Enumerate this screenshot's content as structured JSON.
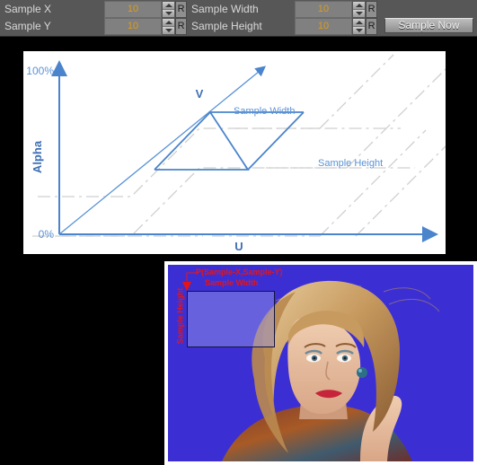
{
  "toolbar": {
    "fields": [
      {
        "label": "Sample X",
        "value": "10",
        "reset": "R"
      },
      {
        "label": "Sample Y",
        "value": "10",
        "reset": "R"
      },
      {
        "label": "Sample Width",
        "value": "10",
        "reset": "R"
      },
      {
        "label": "Sample Height",
        "value": "10",
        "reset": "R"
      }
    ],
    "sample_now_label": "Sample Now",
    "bg_color": "#575757",
    "field_bg_color": "#808080",
    "value_color": "#d99b20"
  },
  "diagram": {
    "y_axis_label": "Alpha",
    "x_axis_label": "U",
    "depth_axis_label": "V",
    "y_tick_top": "100%",
    "y_tick_bottom": "0%",
    "annotations": [
      {
        "name": "sample-width",
        "text": "Sample Width"
      },
      {
        "name": "sample-height",
        "text": "Sample Height"
      }
    ],
    "accent_color": "#5b93d6",
    "ghost_color": "#cfcfcf"
  },
  "photo": {
    "point_label": "P(Sample-X,Sample-Y)",
    "width_label": "Sample Width",
    "height_label": "Sample Height",
    "annotation_color": "#e81414",
    "backdrop_color": "#3b2fd4",
    "selection_border_color": "#14143c"
  },
  "chart_data": {
    "type": "line",
    "title": "",
    "xlabel": "U",
    "ylabel": "Alpha",
    "zlabel": "V",
    "ylim": [
      0,
      100
    ],
    "ytick_labels": [
      "0%",
      "100%"
    ],
    "grid": false,
    "legend": "none",
    "annotations": [
      "Sample Width",
      "Sample Height",
      "V",
      "U",
      "Alpha"
    ],
    "series": [
      {
        "name": "sample-plateau-front",
        "description": "blue parallelogram ramp plateau",
        "values": [
          0,
          0,
          100,
          100
        ]
      },
      {
        "name": "alpha-ramp",
        "description": "diagonal V axis ramp 0% to 100%",
        "values": [
          0,
          100
        ]
      },
      {
        "name": "ghost-plateau-outer",
        "description": "gray dash-dot reference parallelogram",
        "values": [
          0,
          0,
          100,
          100
        ]
      }
    ]
  }
}
